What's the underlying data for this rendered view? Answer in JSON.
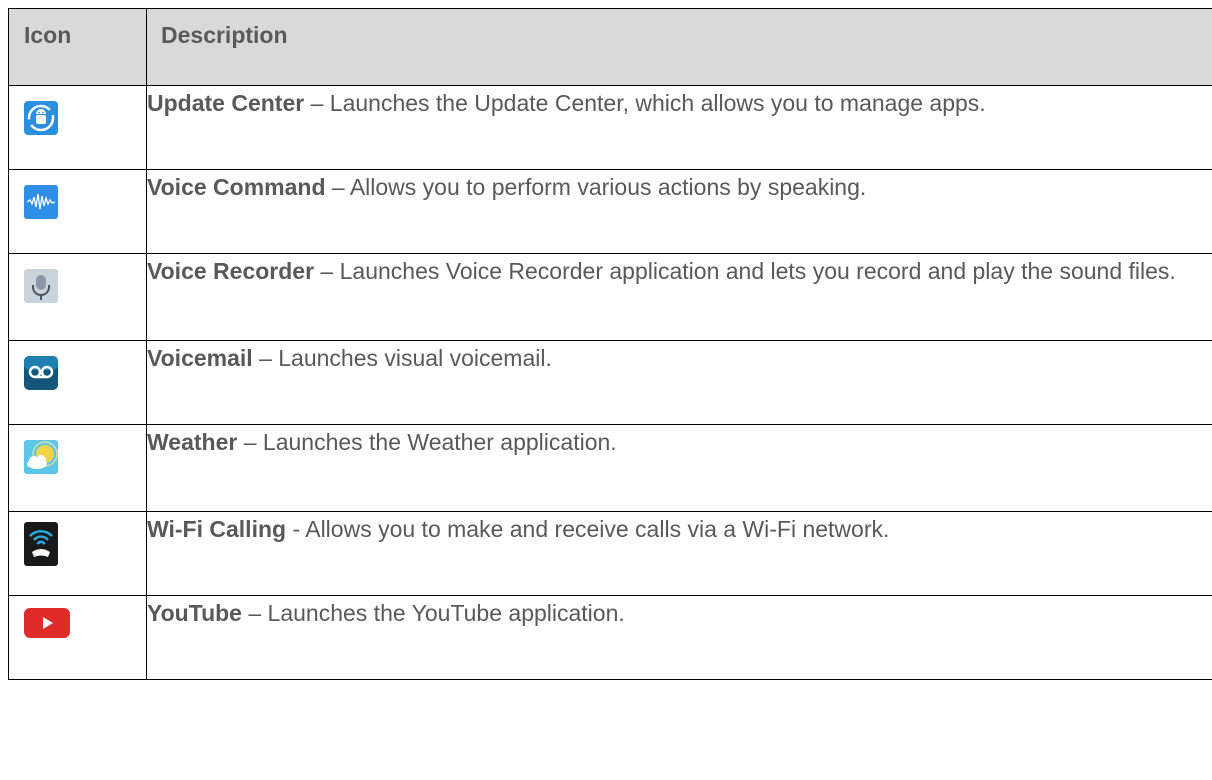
{
  "table": {
    "headers": {
      "icon": "Icon",
      "description": "Description"
    },
    "rows": [
      {
        "icon": "update-center-icon",
        "name": "Update Center",
        "separator": " – ",
        "text": "Launches the Update Center, which allows you to manage apps."
      },
      {
        "icon": "voice-command-icon",
        "name": "Voice Command",
        "separator": " – ",
        "text": "Allows you to perform various actions by speaking."
      },
      {
        "icon": "voice-recorder-icon",
        "name": "Voice Recorder",
        "separator": " – ",
        "text": "Launches Voice Recorder application and lets you record and play the sound files."
      },
      {
        "icon": "voicemail-icon",
        "name": "Voicemail",
        "separator": " – ",
        "text": "Launches visual voicemail."
      },
      {
        "icon": "weather-icon",
        "name": "Weather",
        "separator": " – ",
        "text": "Launches the Weather application."
      },
      {
        "icon": "wifi-calling-icon",
        "name": "Wi-Fi Calling",
        "separator": " - ",
        "text": "Allows you to make and receive calls via a Wi-Fi network."
      },
      {
        "icon": "youtube-icon",
        "name": "YouTube",
        "separator": " – ",
        "text": "Launches the YouTube application."
      }
    ]
  },
  "colors": {
    "header_bg": "#d9d9d9",
    "text": "#595959",
    "border": "#000000"
  }
}
